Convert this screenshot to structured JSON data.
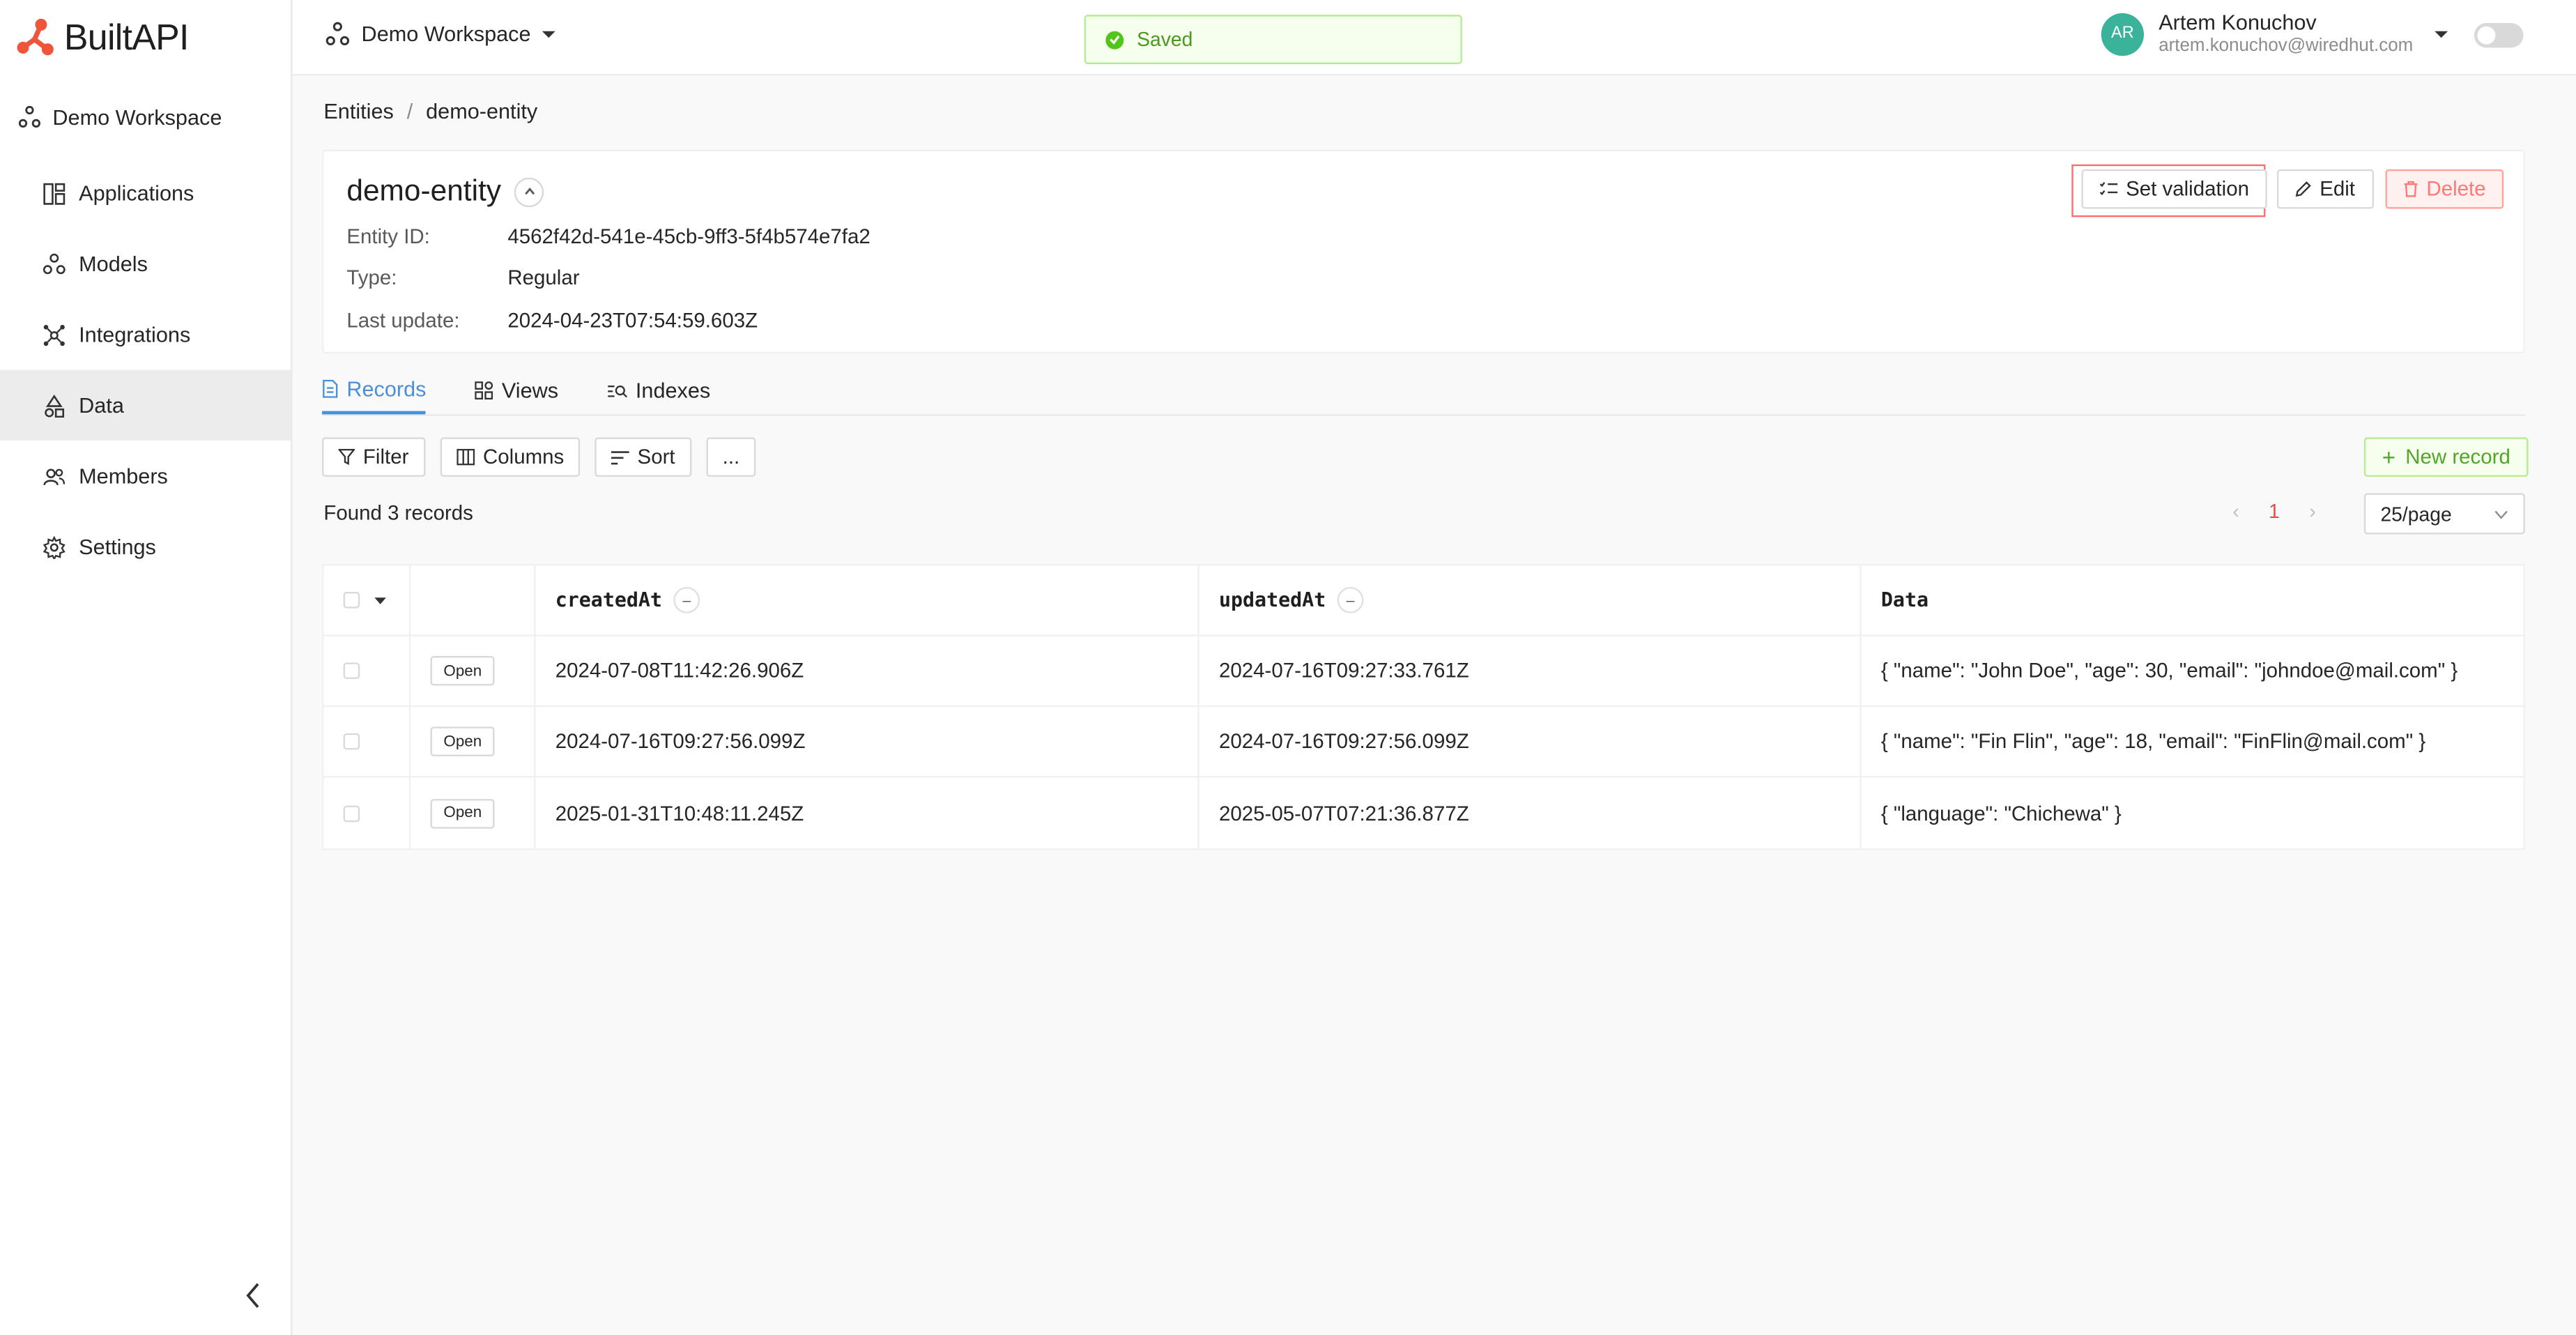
{
  "brand": {
    "name": "BuiltAPI",
    "accent": "#f0543a"
  },
  "sidebar": {
    "workspace": "Demo Workspace",
    "items": [
      {
        "label": "Applications",
        "icon": "applications-icon"
      },
      {
        "label": "Models",
        "icon": "models-icon"
      },
      {
        "label": "Integrations",
        "icon": "integrations-icon"
      },
      {
        "label": "Data",
        "icon": "data-icon",
        "active": true
      },
      {
        "label": "Members",
        "icon": "members-icon"
      },
      {
        "label": "Settings",
        "icon": "gear-icon"
      }
    ]
  },
  "topbar": {
    "workspace": "Demo Workspace",
    "toast": "Saved",
    "user": {
      "initials": "AR",
      "name": "Artem Konuchov",
      "email": "artem.konuchov@wiredhut.com"
    }
  },
  "breadcrumb": {
    "root": "Entities",
    "sep": "/",
    "current": "demo-entity"
  },
  "entity": {
    "title": "demo-entity",
    "fields": [
      {
        "label": "Entity ID:",
        "value": "4562f42d-541e-45cb-9ff3-5f4b574e7fa2"
      },
      {
        "label": "Type:",
        "value": "Regular"
      },
      {
        "label": "Last update:",
        "value": "2024-04-23T07:54:59.603Z"
      }
    ],
    "actions": {
      "validation": "Set validation",
      "edit": "Edit",
      "delete": "Delete"
    }
  },
  "tabs": [
    {
      "label": "Records",
      "active": true
    },
    {
      "label": "Views"
    },
    {
      "label": "Indexes"
    }
  ],
  "toolbar": {
    "filter": "Filter",
    "columns": "Columns",
    "sort": "Sort",
    "more": "...",
    "new_record": "New record"
  },
  "records": {
    "found": "Found 3 records",
    "page": "1",
    "page_size": "25/page",
    "columns": [
      "createdAt",
      "updatedAt",
      "Data"
    ],
    "open_label": "Open",
    "rows": [
      {
        "createdAt": "2024-07-08T11:42:26.906Z",
        "updatedAt": "2024-07-16T09:27:33.761Z",
        "data": "{ \"name\": \"John Doe\", \"age\": 30, \"email\": \"johndoe@mail.com\" }"
      },
      {
        "createdAt": "2024-07-16T09:27:56.099Z",
        "updatedAt": "2024-07-16T09:27:56.099Z",
        "data": "{ \"name\": \"Fin Flin\", \"age\": 18, \"email\": \"FinFlin@mail.com\" }"
      },
      {
        "createdAt": "2025-01-31T10:48:11.245Z",
        "updatedAt": "2025-05-07T07:21:36.877Z",
        "data": "{ \"language\": \"Chichewa\" }"
      }
    ]
  }
}
